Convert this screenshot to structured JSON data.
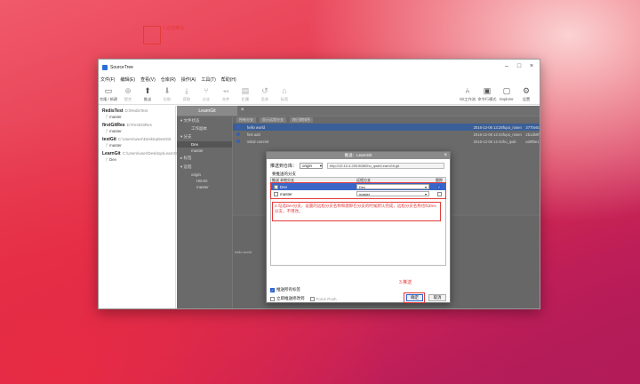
{
  "window": {
    "title": "SourceTree"
  },
  "menu": [
    "文件(F)",
    "编辑(E)",
    "查看(V)",
    "仓库(R)",
    "操作(A)",
    "工具(T)",
    "帮助(H)"
  ],
  "toolbar": {
    "buttons": [
      {
        "label": "克隆 / 新建",
        "icon": "clone-icon"
      },
      {
        "label": "提交",
        "icon": "commit-icon"
      },
      {
        "label": "推送",
        "icon": "push-icon"
      },
      {
        "label": "拉取",
        "icon": "pull-icon"
      },
      {
        "label": "获取",
        "icon": "fetch-icon"
      },
      {
        "label": "分支",
        "icon": "branch-icon"
      },
      {
        "label": "合并",
        "icon": "merge-icon"
      },
      {
        "label": "贮藏",
        "icon": "stash-icon"
      },
      {
        "label": "丢弃",
        "icon": "discard-icon"
      },
      {
        "label": "标签",
        "icon": "tag-icon"
      }
    ],
    "right_buttons": [
      {
        "label": "Git工作流",
        "icon": "gitflow-icon"
      },
      {
        "label": "命令行模式",
        "icon": "terminal-icon"
      },
      {
        "label": "Explorer",
        "icon": "explorer-icon"
      },
      {
        "label": "设置",
        "icon": "settings-icon"
      }
    ],
    "annotation_push": "1.点击推送"
  },
  "sidebar": {
    "repos": [
      {
        "name": "RedisTest",
        "path": "D:\\RedisTest",
        "branch": "master"
      },
      {
        "name": "firstGitRes",
        "path": "D:\\FirstGitRes",
        "branch": "master"
      },
      {
        "name": "testGit",
        "path": "C:\\Users\\user\\Desktop\\testGit",
        "branch": "master"
      },
      {
        "name": "LearnGit",
        "path": "C:\\Users\\user\\Desktop\\LearnGit",
        "branch": "Dev"
      }
    ]
  },
  "main": {
    "tab": "LearnGit",
    "nav": {
      "file_status": "文件状态",
      "working_copy": "工作副本",
      "branches": "分支",
      "branch_items": [
        "Dev",
        "master"
      ],
      "tags": "标签",
      "remotes": "远程",
      "remote_name": "origin",
      "remote_items": [
        "HEAD",
        "master"
      ]
    },
    "graph_toolbar": [
      "所有分支",
      "显示远程分支",
      "按日期排序"
    ],
    "commits": [
      {
        "msg": "hello world",
        "date": "2016-12-06 13:28",
        "author": "fupo_rosen",
        "hash": "3770e0d"
      },
      {
        "msg": "first add",
        "date": "2016-12-06 12:44",
        "author": "fupo_rosen",
        "hash": "2b1db9f"
      },
      {
        "msg": "initial commit",
        "date": "2016-12-06 12:43",
        "author": "hu_qwb",
        "hash": "a29f6e1"
      }
    ],
    "details_text": "hello world"
  },
  "dialog": {
    "title": "推送：LearnGit",
    "push_to_label": "推送到仓库：",
    "remote": "origin",
    "remote_url": "http://10.10.4.200:8080/hu_qwb/LearnGit.git",
    "branches_label": "要推送的分支",
    "headers": {
      "push": "推送",
      "local": "本地分支",
      "remote": "远程分支",
      "track": "跟踪"
    },
    "rows": [
      {
        "push": true,
        "local": "Dev",
        "remote": "Dev",
        "track": true
      },
      {
        "push": false,
        "local": "master",
        "remote": "master",
        "track": false
      }
    ],
    "note": "2.勾选Dev分支，设置的远程分支名称和建即在分支的时候默认完成，远程分支名称也叫Dev分支，不用改。",
    "annotation_ok": "3.推送",
    "push_all_tags": "推送所有标签",
    "immediate_push": "立即推送修改到",
    "force_push": "Force Push",
    "ok": "确定",
    "cancel": "取消"
  },
  "colors": {
    "annotation": "#e23b3b",
    "selection": "#3a66c8"
  }
}
